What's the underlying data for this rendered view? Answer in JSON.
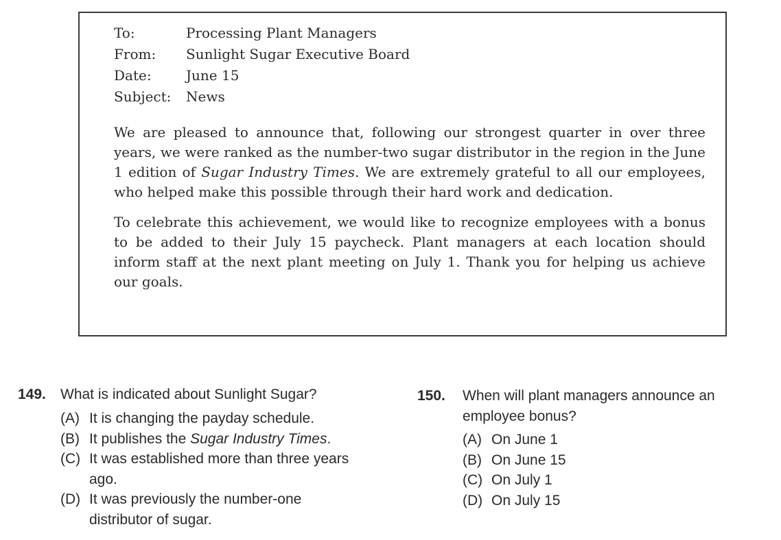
{
  "memo": {
    "to_label": "To:",
    "to_value": "Processing Plant Managers",
    "from_label": "From:",
    "from_value": "Sunlight Sugar Executive Board",
    "date_label": "Date:",
    "date_value": "June 15",
    "subject_label": "Subject:",
    "subject_value": "News",
    "para1_before": "We are pleased to announce that, following our strongest quarter in over three years, we were ranked as the number-two sugar distributor in the region in the June 1 edition of ",
    "para1_italic": "Sugar Industry Times",
    "para1_after": ". We are extremely grateful to all our employees, who helped make this possible through their hard work and dedication.",
    "para2": "To celebrate this achievement, we would like to recognize employees with a bonus to be added to their July 15 paycheck. Plant managers at each location should inform staff at the next plant meeting on July 1. Thank you for helping us achieve our goals."
  },
  "questions": {
    "q149": {
      "number": "149.",
      "text": "What is indicated about Sunlight Sugar?",
      "options": [
        {
          "letter": "(A)",
          "text": "It is changing the payday schedule."
        },
        {
          "letter": "(B)",
          "text_before": "It publishes the ",
          "text_italic": "Sugar Industry Times",
          "text_after": "."
        },
        {
          "letter": "(C)",
          "text": "It was established more than three years ago."
        },
        {
          "letter": "(D)",
          "text": "It was previously the number-one distributor of sugar."
        }
      ]
    },
    "q150": {
      "number": "150.",
      "text": "When will plant managers announce an employee bonus?",
      "options": [
        {
          "letter": "(A)",
          "text": "On June 1"
        },
        {
          "letter": "(B)",
          "text": "On June 15"
        },
        {
          "letter": "(C)",
          "text": "On July 1"
        },
        {
          "letter": "(D)",
          "text": "On July 15"
        }
      ]
    }
  }
}
